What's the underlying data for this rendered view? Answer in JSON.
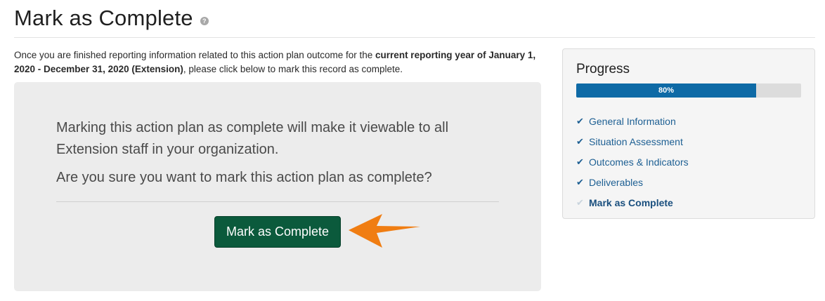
{
  "header": {
    "title": "Mark as Complete",
    "help_icon": "?"
  },
  "intro": {
    "text_before": "Once you are finished reporting information related to this action plan outcome for the ",
    "bold_text": "current reporting year of January 1, 2020 - December 31, 2020 (Extension)",
    "text_after": ", please click below to mark this record as complete."
  },
  "confirm": {
    "message": "Marking this action plan as complete will make it viewable to all Extension staff in your organization.",
    "question": "Are you sure you want to mark this action plan as complete?",
    "button_label": "Mark as Complete",
    "button_color": "#0b5a3c",
    "arrow_color": "#f07d12"
  },
  "progress": {
    "heading": "Progress",
    "percent": 80,
    "percent_label": "80%",
    "bar_color": "#0e6aa6",
    "steps": [
      {
        "label": "General Information",
        "done": true,
        "icon": "check-icon"
      },
      {
        "label": "Situation Assessment",
        "done": true,
        "icon": "check-icon"
      },
      {
        "label": "Outcomes & Indicators",
        "done": true,
        "icon": "check-icon"
      },
      {
        "label": "Deliverables",
        "done": true,
        "icon": "check-icon"
      },
      {
        "label": "Mark as Complete",
        "done": false,
        "current": true,
        "icon": "check-icon"
      }
    ]
  }
}
